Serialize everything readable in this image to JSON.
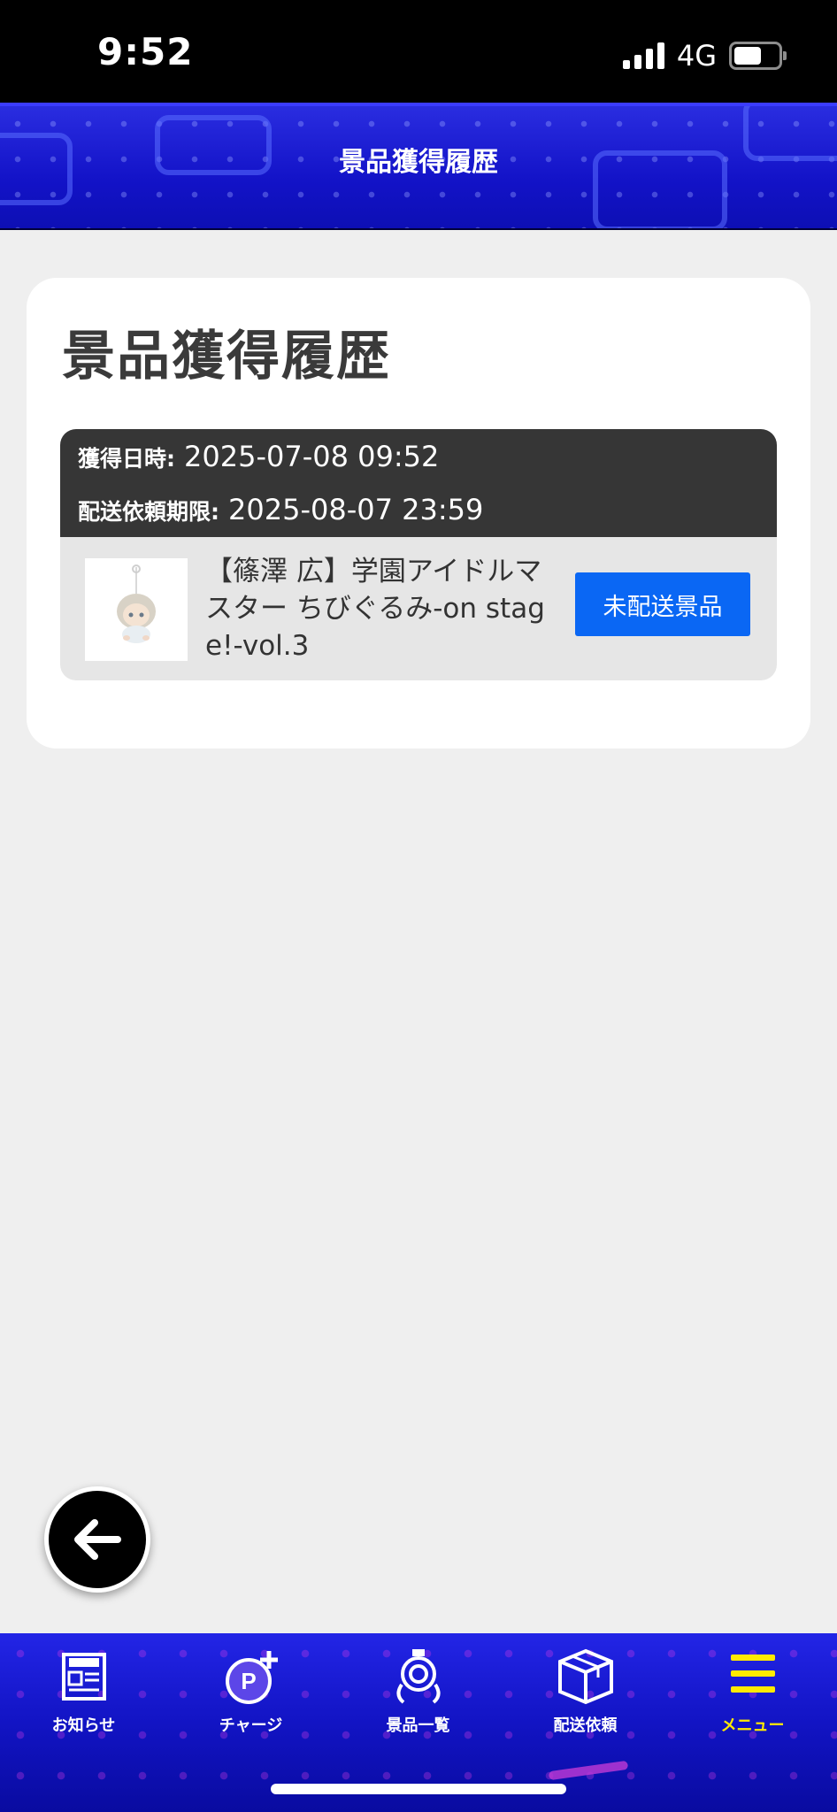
{
  "status_bar": {
    "time": "9:52",
    "network": "4G"
  },
  "header": {
    "title": "景品獲得履歴"
  },
  "card": {
    "title": "景品獲得履歴",
    "entries": [
      {
        "acquired_label": "獲得日時:",
        "acquired_value": "2025-07-08 09:52",
        "deadline_label": "配送依頼期限:",
        "deadline_value": "2025-08-07 23:59",
        "prize_name": "【篠澤 広】学園アイドルマスター ちびぐるみ-on stage!-vol.3",
        "status_button": "未配送景品"
      }
    ]
  },
  "bottom_nav": {
    "items": [
      {
        "label": "お知らせ",
        "icon": "news-icon"
      },
      {
        "label": "チャージ",
        "icon": "point-charge-icon"
      },
      {
        "label": "景品一覧",
        "icon": "prize-catcher-icon"
      },
      {
        "label": "配送依頼",
        "icon": "box-icon"
      },
      {
        "label": "メニュー",
        "icon": "menu-icon",
        "active": true
      }
    ]
  },
  "colors": {
    "header_blue": "#1313c8",
    "accent_button": "#0a67f4",
    "active_nav": "#ffea00",
    "entry_header": "#363636"
  }
}
